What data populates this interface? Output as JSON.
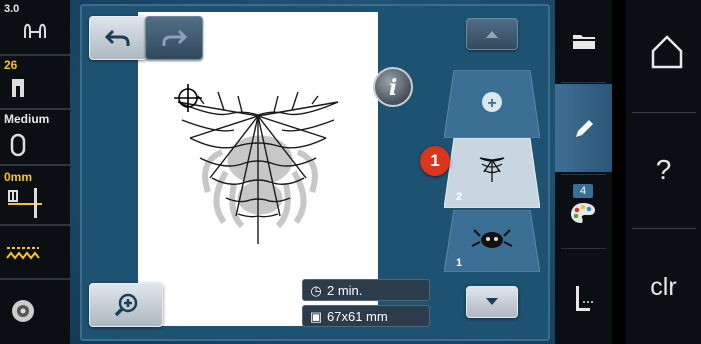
{
  "left_status": {
    "tension": {
      "value": "3.0",
      "icon": "tension-icon"
    },
    "presser_foot": {
      "value": "26",
      "icon": "presser-foot-icon"
    },
    "needle_plate": {
      "value": "Medium",
      "icon": "hoop-icon"
    },
    "needle": {
      "value": "0mm",
      "icon": "needle-icon"
    },
    "feed_dog": {
      "icon": "feed-dog-icon"
    },
    "bobbin": {
      "icon": "bobbin-icon"
    }
  },
  "toolbar": {
    "undo": "undo-arrow-icon",
    "redo": "redo-arrow-icon",
    "info_label": "i",
    "zoom": "zoom-plus-icon"
  },
  "status": {
    "time": "2 min.",
    "size": "67x61 mm"
  },
  "layers": {
    "scroll_up": "chevron-up-icon",
    "add": "+",
    "items": [
      {
        "number": "2",
        "thumbnail": "spiderweb-thumbnail",
        "selected": true
      },
      {
        "number": "1",
        "thumbnail": "spider-thumbnail",
        "selected": false
      }
    ],
    "scroll_down": "chevron-down-icon",
    "marker": "1"
  },
  "tabs": {
    "folder": "folder-icon",
    "edit": "pencil-icon",
    "colors_badge": "4",
    "colors": "palette-icon",
    "stitch": "stitch-icon"
  },
  "system": {
    "home": "home-icon",
    "help": "?",
    "clear": "clr"
  }
}
